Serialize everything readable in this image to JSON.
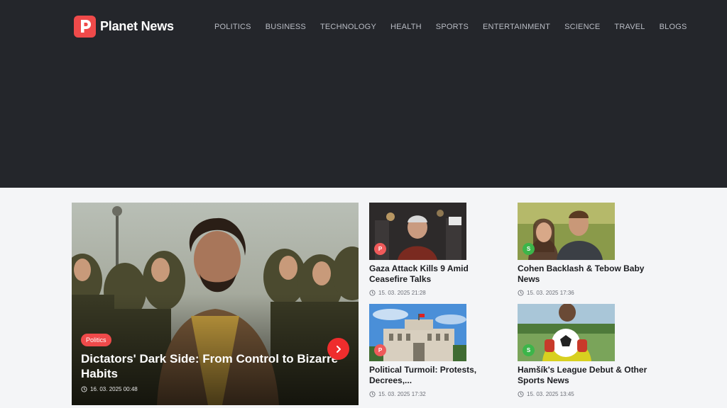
{
  "brand": {
    "name": "Planet News",
    "logo_letter": "P",
    "accent": "#ef4a4a"
  },
  "nav": {
    "items": [
      "POLITICS",
      "BUSINESS",
      "TECHNOLOGY",
      "HEALTH",
      "SPORTS",
      "ENTERTAINMENT",
      "SCIENCE",
      "TRAVEL",
      "BLOGS"
    ],
    "language_icon": "uk-flag-icon"
  },
  "hero": {
    "category": "Politics",
    "title": "Dictators' Dark Side: From Control to Bizarre Habits",
    "date": "16. 03. 2025 00:48",
    "next_icon": "chevron-right-icon"
  },
  "cards": [
    {
      "badge": "P",
      "badge_color": "#ef5a5a",
      "title": "Gaza Attack Kills 9 Amid Ceasefire Talks",
      "date": "15. 03. 2025 21:28"
    },
    {
      "badge": "S",
      "badge_color": "#3cb54a",
      "title": "Cohen Backlash & Tebow Baby News",
      "date": "15. 03. 2025 17:36"
    },
    {
      "badge": "P",
      "badge_color": "#ef5a5a",
      "title": "Political Turmoil: Protests, Decrees,...",
      "date": "15. 03. 2025 17:32"
    },
    {
      "badge": "S",
      "badge_color": "#3cb54a",
      "title": "Hamšík's League Debut & Other Sports News",
      "date": "15. 03. 2025 13:45"
    }
  ]
}
